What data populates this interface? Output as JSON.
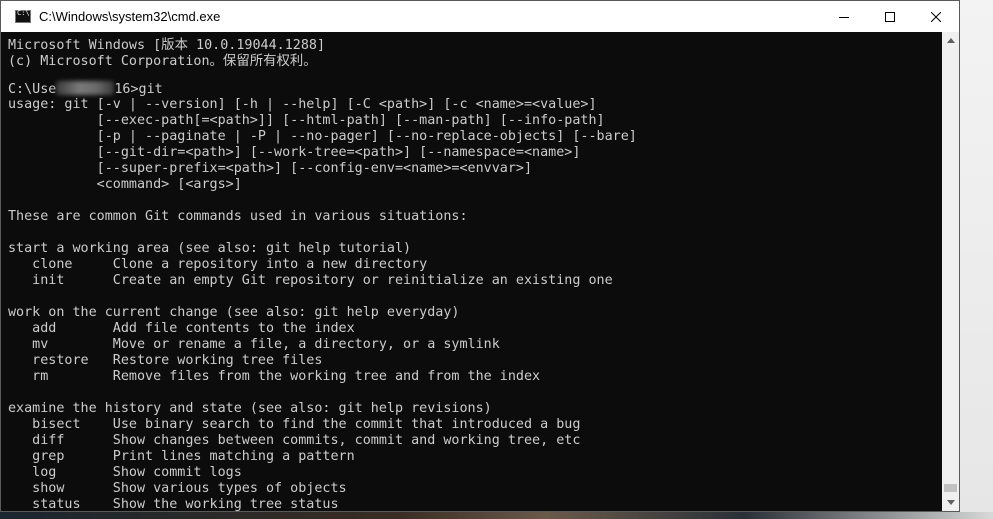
{
  "window": {
    "title": "C:\\Windows\\system32\\cmd.exe"
  },
  "controls": {
    "minimize": "minimize-icon",
    "maximize": "maximize-icon",
    "close": "close-icon"
  },
  "console": {
    "lines": [
      "Microsoft Windows [版本 10.0.19044.1288]",
      "(c) Microsoft Corporation。保留所有权利。",
      "",
      "",
      "usage: git [-v | --version] [-h | --help] [-C <path>] [-c <name>=<value>]",
      "           [--exec-path[=<path>]] [--html-path] [--man-path] [--info-path]",
      "           [-p | --paginate | -P | --no-pager] [--no-replace-objects] [--bare]",
      "           [--git-dir=<path>] [--work-tree=<path>] [--namespace=<name>]",
      "           [--super-prefix=<path>] [--config-env=<name>=<envvar>]",
      "           <command> [<args>]",
      "",
      "These are common Git commands used in various situations:",
      "",
      "start a working area (see also: git help tutorial)",
      "   clone     Clone a repository into a new directory",
      "   init      Create an empty Git repository or reinitialize an existing one",
      "",
      "work on the current change (see also: git help everyday)",
      "   add       Add file contents to the index",
      "   mv        Move or rename a file, a directory, or a symlink",
      "   restore   Restore working tree files",
      "   rm        Remove files from the working tree and from the index",
      "",
      "examine the history and state (see also: git help revisions)",
      "   bisect    Use binary search to find the commit that introduced a bug",
      "   diff      Show changes between commits, commit and working tree, etc",
      "   grep      Print lines matching a pattern",
      "   log       Show commit logs",
      "   show      Show various types of objects",
      "   status    Show the working tree status"
    ],
    "prompt_prefix": "C:\\Use",
    "prompt_suffix": "16>git"
  },
  "colors": {
    "console_bg": "#0c0c0c",
    "console_fg": "#cccccc",
    "titlebar_bg": "#ffffff"
  }
}
